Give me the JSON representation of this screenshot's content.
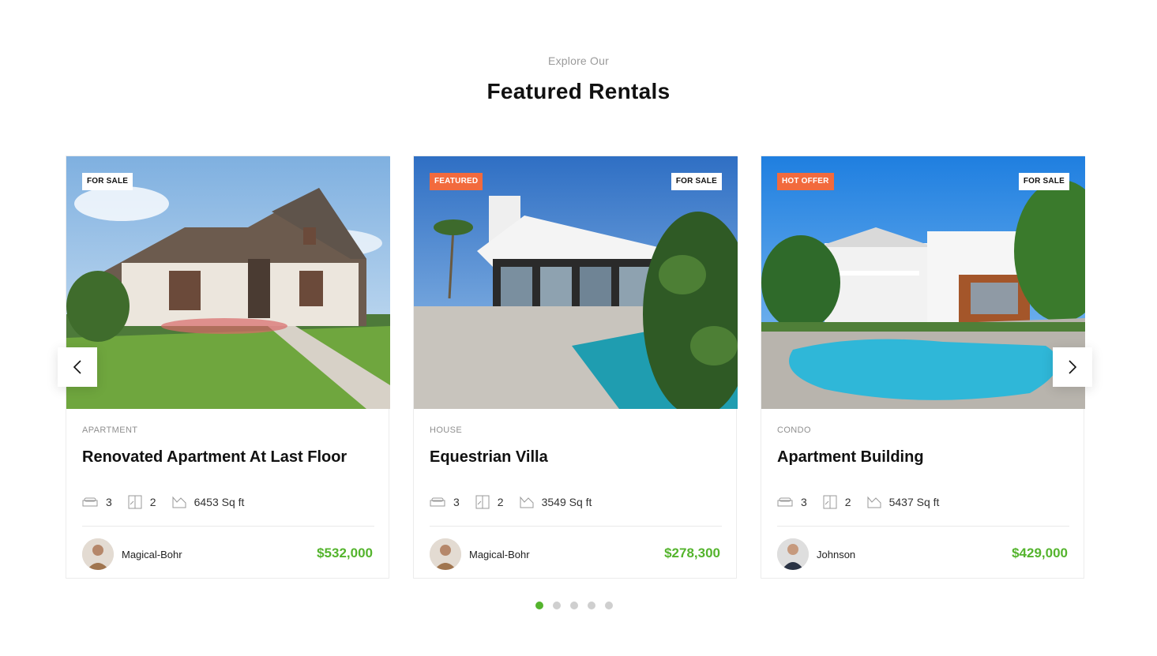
{
  "section": {
    "eyebrow": "Explore Our",
    "title": "Featured Rentals"
  },
  "cards": [
    {
      "badges": [
        "FOR SALE"
      ],
      "category": "APARTMENT",
      "title": "Renovated Apartment At Last Floor",
      "beds": "3",
      "baths": "2",
      "area": "6453 Sq ft",
      "agent": "Magical-Bohr",
      "price": "$532,000"
    },
    {
      "badges": [
        "FEATURED",
        "FOR SALE"
      ],
      "category": "HOUSE",
      "title": "Equestrian Villa",
      "beds": "3",
      "baths": "2",
      "area": "3549 Sq ft",
      "agent": "Magical-Bohr",
      "price": "$278,300"
    },
    {
      "badges": [
        "HOT OFFER",
        "FOR SALE"
      ],
      "category": "CONDO",
      "title": "Apartment Building",
      "beds": "3",
      "baths": "2",
      "area": "5437 Sq ft",
      "agent": "Johnson",
      "price": "$429,000"
    }
  ],
  "icons": {
    "bed": "bed-icon",
    "bath": "bath-icon",
    "area": "area-icon",
    "prev": "chevron-left-icon",
    "next": "chevron-right-icon"
  },
  "pagination": {
    "count": 5,
    "active": 1
  },
  "colors": {
    "price": "#54b42d",
    "badge_orange": "#f26a3d",
    "dot_active": "#54b42d",
    "dot_inactive": "#cfcfcf"
  }
}
